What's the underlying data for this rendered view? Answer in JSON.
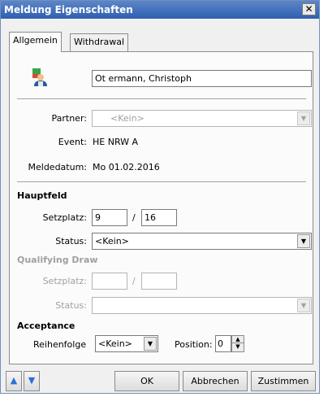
{
  "window": {
    "title": "Meldung Eigenschaften",
    "close_glyph": "✕"
  },
  "tabs": [
    {
      "label": "Allgemein"
    },
    {
      "label": "Withdrawal"
    }
  ],
  "player": {
    "name": "Ot ermann, Christoph",
    "icon": "person-icon"
  },
  "partner": {
    "label": "Partner:",
    "value": "<Kein>"
  },
  "event": {
    "label": "Event:",
    "value": "HE NRW A"
  },
  "meldedatum": {
    "label": "Meldedatum:",
    "value": "Mo 01.02.2016"
  },
  "hauptfeld": {
    "heading": "Hauptfeld",
    "setzplatz_label": "Setzplatz:",
    "setzplatz_value": "9",
    "slash": "/",
    "setzplatz_total": "16",
    "status_label": "Status:",
    "status_value": "<Kein>"
  },
  "qualifying": {
    "heading": "Qualifying Draw",
    "setzplatz_label": "Setzplatz:",
    "setzplatz_value": "",
    "slash": "/",
    "setzplatz_total": "",
    "status_label": "Status:",
    "status_value": ""
  },
  "acceptance": {
    "heading": "Acceptance",
    "reihenfolge_label": "Reihenfolge",
    "reihenfolge_value": "<Kein>",
    "position_label": "Position:",
    "position_value": "0"
  },
  "buttons": {
    "up_glyph": "▲",
    "down_glyph": "▼",
    "ok": "OK",
    "cancel": "Abbrechen",
    "agree": "Zustimmen"
  },
  "combo_arrow": "▼",
  "spin": {
    "up": "▲",
    "down": "▼"
  },
  "colors": {
    "titlebar": "#2d5fb0",
    "disabled_text": "#a0a0a0",
    "nav_arrow": "#2b6fd6"
  }
}
